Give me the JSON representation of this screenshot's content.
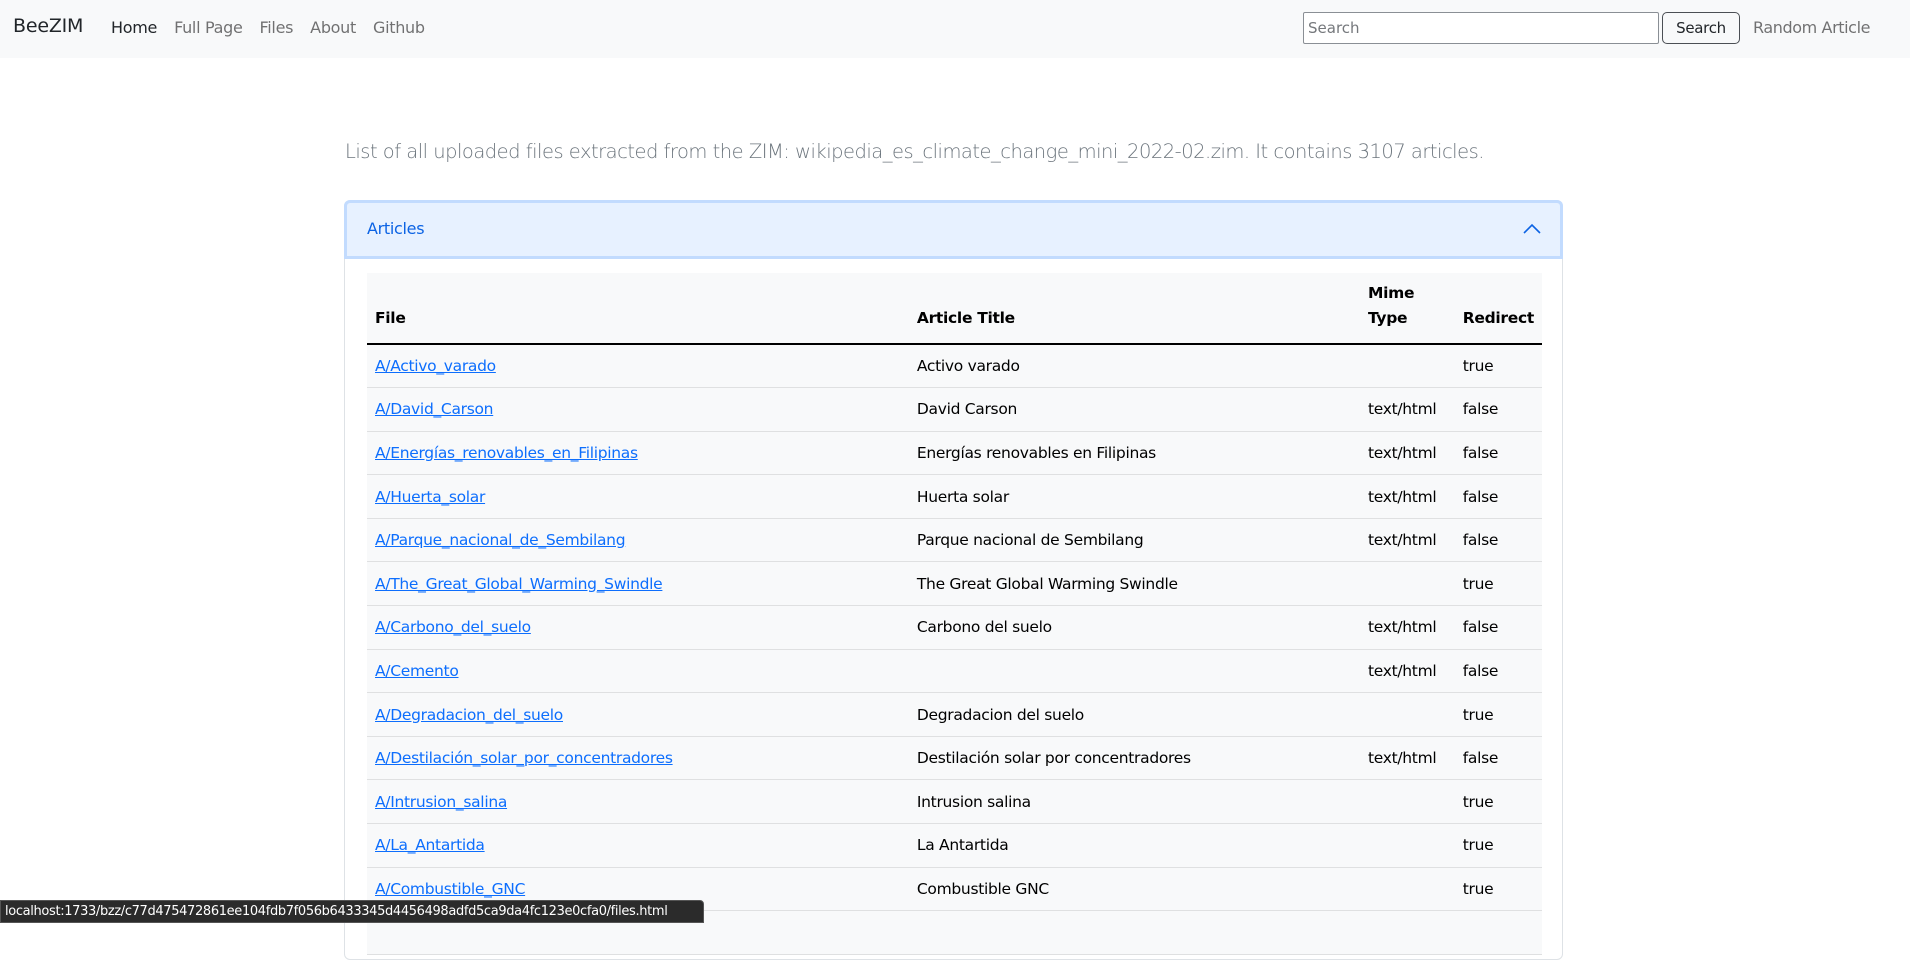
{
  "navbar": {
    "brand": "BeeZIM",
    "links": [
      {
        "label": "Home",
        "active": true
      },
      {
        "label": "Full Page",
        "active": false
      },
      {
        "label": "Files",
        "active": false
      },
      {
        "label": "About",
        "active": false
      },
      {
        "label": "Github",
        "active": false
      }
    ],
    "search": {
      "placeholder": "Search",
      "value": ""
    },
    "search_button": "Search",
    "random_article": "Random Article"
  },
  "lead": "List of all uploaded files extracted from the ZIM: wikipedia_es_climate_change_mini_2022-02.zim. It contains 3107 articles.",
  "accordion": {
    "title": "Articles",
    "expanded": true,
    "icon": "chevron-up-icon"
  },
  "table": {
    "headers": [
      "File",
      "Article Title",
      "Mime Type",
      "Redirect"
    ],
    "rows": [
      {
        "file": "A/Activo_varado",
        "title": "Activo varado",
        "mime": "",
        "redirect": "true"
      },
      {
        "file": "A/David_Carson",
        "title": "David Carson",
        "mime": "text/html",
        "redirect": "false"
      },
      {
        "file": "A/Energías_renovables_en_Filipinas",
        "title": "Energías renovables en Filipinas",
        "mime": "text/html",
        "redirect": "false"
      },
      {
        "file": "A/Huerta_solar",
        "title": "Huerta solar",
        "mime": "text/html",
        "redirect": "false"
      },
      {
        "file": "A/Parque_nacional_de_Sembilang",
        "title": "Parque nacional de Sembilang",
        "mime": "text/html",
        "redirect": "false"
      },
      {
        "file": "A/The_Great_Global_Warming_Swindle",
        "title": "The Great Global Warming Swindle",
        "mime": "",
        "redirect": "true"
      },
      {
        "file": "A/Carbono_del_suelo",
        "title": "Carbono del suelo",
        "mime": "text/html",
        "redirect": "false"
      },
      {
        "file": "A/Cemento",
        "title": "",
        "mime": "text/html",
        "redirect": "false"
      },
      {
        "file": "A/Degradacion_del_suelo",
        "title": "Degradacion del suelo",
        "mime": "",
        "redirect": "true"
      },
      {
        "file": "A/Destilación_solar_por_concentradores",
        "title": "Destilación solar por concentradores",
        "mime": "text/html",
        "redirect": "false"
      },
      {
        "file": "A/Intrusion_salina",
        "title": "Intrusion salina",
        "mime": "",
        "redirect": "true"
      },
      {
        "file": "A/La_Antartida",
        "title": "La Antartida",
        "mime": "",
        "redirect": "true"
      },
      {
        "file": "A/Combustible_GNC",
        "title": "Combustible GNC",
        "mime": "",
        "redirect": "true"
      },
      {
        "file": "",
        "title": "",
        "mime": "",
        "redirect": ""
      }
    ]
  },
  "status_bar": "localhost:1733/bzz/c77d475472861ee104fdb7f056b6433345d4456498adfd5ca9da4fc123e0cfa0/files.html"
}
